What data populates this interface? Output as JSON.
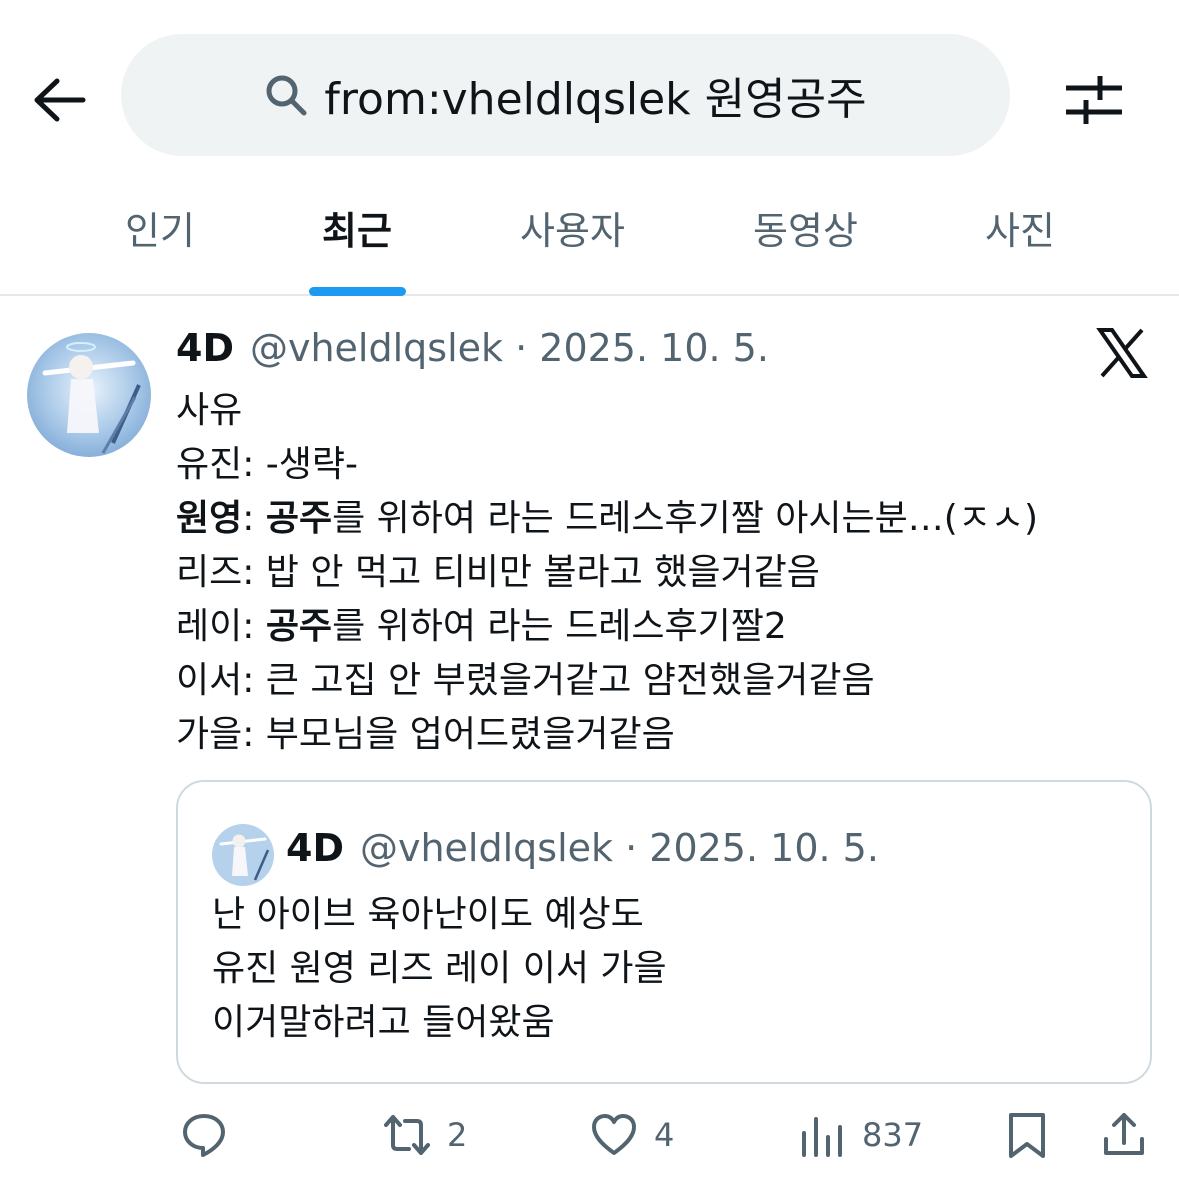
{
  "header": {
    "back_icon": "arrow-left-icon",
    "search_query": "from:vheldlqslek 원영공주",
    "search_icon": "search-icon",
    "filter_icon": "sliders-icon"
  },
  "tabs": [
    {
      "label": "인기",
      "active": false
    },
    {
      "label": "최근",
      "active": true
    },
    {
      "label": "사용자",
      "active": false
    },
    {
      "label": "동영상",
      "active": false
    },
    {
      "label": "사진",
      "active": false
    }
  ],
  "colors": {
    "accent": "#1d9bf0",
    "muted": "#536471",
    "text": "#0f1419",
    "border": "#cfd9de"
  },
  "tweet": {
    "name": "4D",
    "meta": "@vheldlqslek · 2025. 10. 5.",
    "source_icon": "x-logo-icon",
    "lines": [
      {
        "pre": "사유",
        "bold": "",
        "post": ""
      },
      {
        "pre": "유진: -생략-",
        "bold": "",
        "post": ""
      },
      {
        "pre": "",
        "bold": "원영",
        "post": ": "
      },
      {
        "pre": "리즈: 밥 안 먹고 티비만 볼라고 했을거같음",
        "bold": "",
        "post": ""
      },
      {
        "pre": "레이: ",
        "bold": "공주",
        "post": "를 위하여 라는 드레스후기짤2"
      },
      {
        "pre": "이서: 큰 고집 안 부렸을거같고 얌전했을거같음",
        "bold": "",
        "post": ""
      },
      {
        "pre": "가을: 부모님을 업어드렸을거같음",
        "bold": "",
        "post": ""
      }
    ],
    "line3_bold2": "공주",
    "line3_rest": "를 위하여 라는 드레스후기짤 아시는분…(ㅈㅅ)"
  },
  "quote": {
    "name": "4D",
    "meta": "@vheldlqslek · 2025. 10. 5.",
    "lines": [
      "난 아이브 육아난이도 예상도",
      "유진 원영 리즈 레이 이서 가을",
      "이거말하려고 들어왔움"
    ]
  },
  "actions": {
    "reply_icon": "reply-icon",
    "retweet_icon": "retweet-icon",
    "retweets": "2",
    "like_icon": "heart-icon",
    "likes": "4",
    "views_icon": "views-icon",
    "views": "837",
    "bookmark_icon": "bookmark-icon",
    "share_icon": "share-icon"
  }
}
